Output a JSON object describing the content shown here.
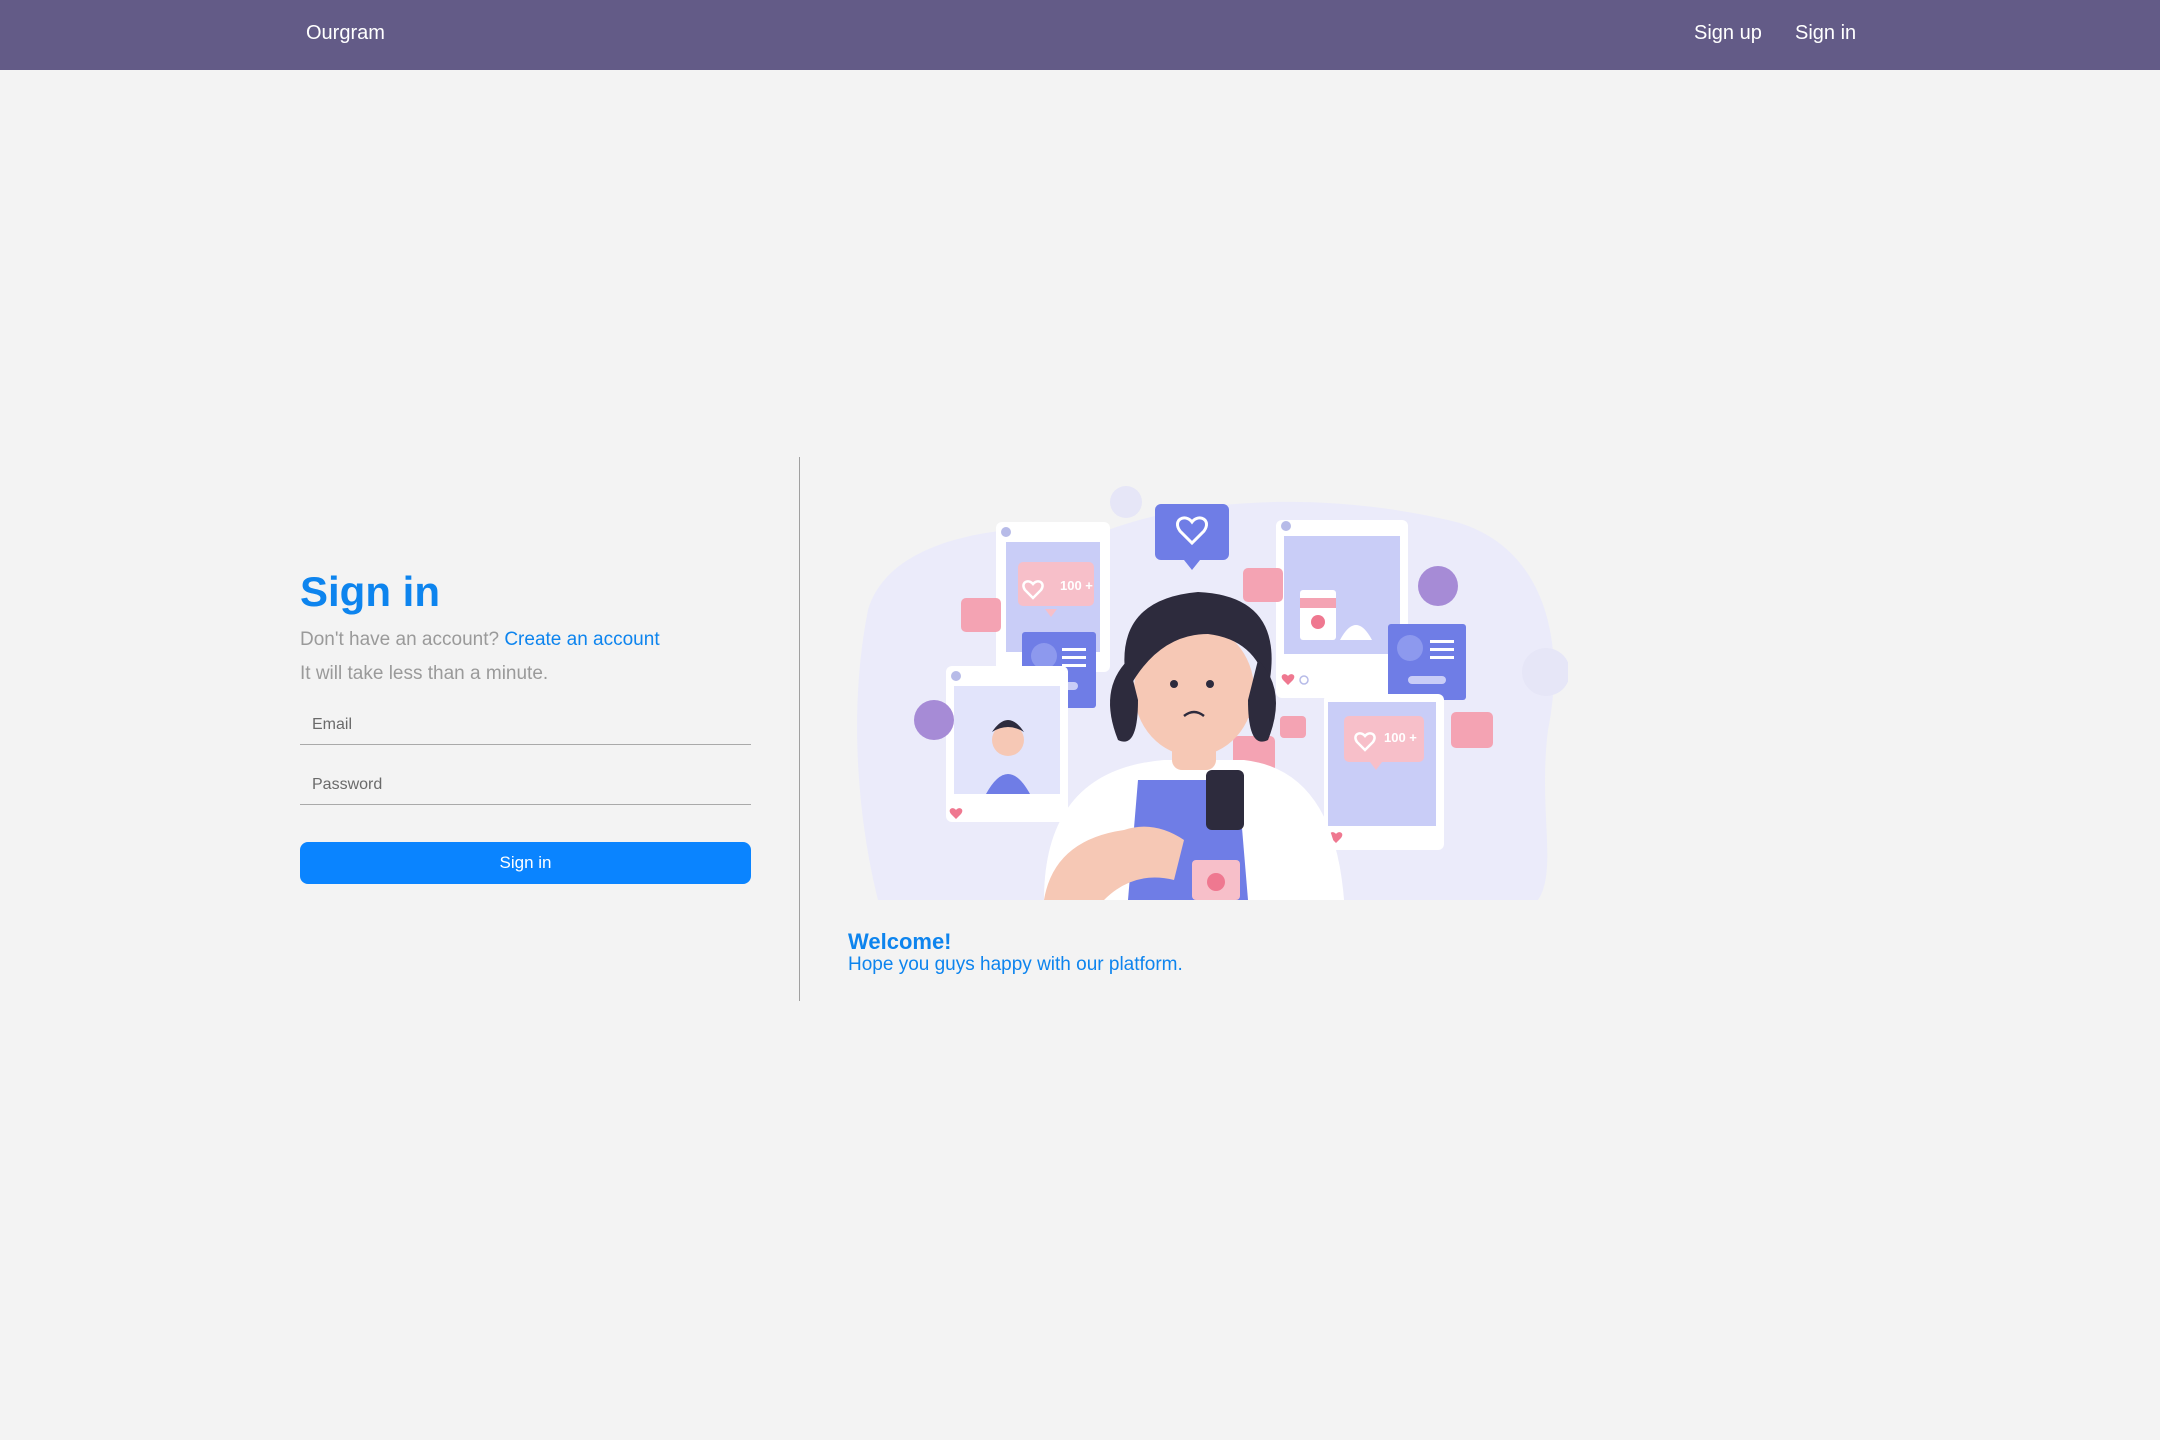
{
  "navbar": {
    "brand": "Ourgram",
    "links": [
      {
        "label": "Sign up"
      },
      {
        "label": "Sign in"
      }
    ]
  },
  "signin": {
    "title": "Sign in",
    "prompt": "Don't have an account?",
    "create_link": "Create an account",
    "note": "It will take less than a minute.",
    "email_placeholder": "Email",
    "password_placeholder": "Password",
    "submit_label": "Sign in"
  },
  "welcome": {
    "title": "Welcome!",
    "text": "Hope you guys happy with our platform."
  },
  "illustration": {
    "badge_a": "100 +",
    "badge_b": "100 +"
  },
  "colors": {
    "navbar": "#635b87",
    "accent": "#0a84ff",
    "text_blue": "#0d84ee",
    "background": "#f3f3f3"
  }
}
